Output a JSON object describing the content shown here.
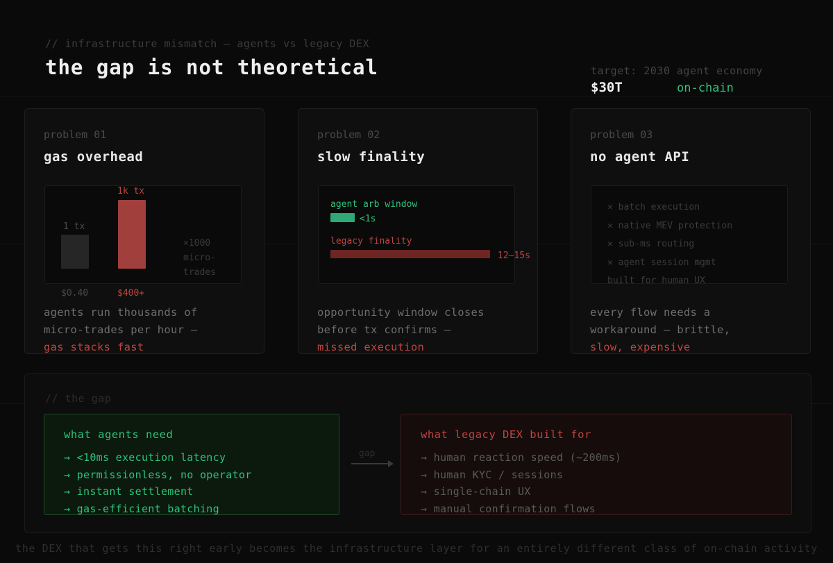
{
  "header": {
    "comment": "// infrastructure mismatch — agents vs legacy DEX",
    "title": "the gap is not theoretical",
    "target_label": "target: 2030 agent economy",
    "target_value": "$30T",
    "target_suffix": "on-chain"
  },
  "cards": [
    {
      "number": "problem 01",
      "title": "gas overhead",
      "chart": {
        "bars": [
          {
            "label": "1 tx",
            "value_label": "$0.40",
            "value": 0.4
          },
          {
            "label": "1k tx",
            "value_label": "$400+",
            "value": 400
          }
        ],
        "multiplier": [
          "×1000",
          "micro-",
          "trades"
        ]
      },
      "desc": [
        "agents run thousands of",
        "micro-trades per hour —"
      ],
      "desc_emphasis": "gas stacks fast"
    },
    {
      "number": "problem 02",
      "title": "slow finality",
      "timeline": {
        "arb_label": "agent arb window",
        "arb_value": "<1s",
        "legacy_label": "legacy finality",
        "legacy_value": "12–15s"
      },
      "desc": [
        "opportunity window closes",
        "before tx confirms —"
      ],
      "desc_emphasis": "missed execution"
    },
    {
      "number": "problem 03",
      "title": "no agent API",
      "missing": [
        "batch execution",
        "native MEV protection",
        "sub-ms routing",
        "agent session mgmt"
      ],
      "missing_footer": "built for human UX",
      "desc": [
        "every flow needs a",
        "workaround — brittle,"
      ],
      "desc_emphasis": "slow, expensive"
    }
  ],
  "gap": {
    "comment": "// the gap",
    "arrow_label": "gap",
    "need": {
      "title": "what agents need",
      "items": [
        "→ <10ms execution latency",
        "→ permissionless, no operator",
        "→ instant settlement",
        "→ gas-efficient batching"
      ]
    },
    "legacy": {
      "title": "what legacy DEX built for",
      "items": [
        "→ human reaction speed (~200ms)",
        "→ human KYC / sessions",
        "→ single-chain UX",
        "→ manual confirmation flows"
      ]
    }
  },
  "footer": "the DEX that gets this right early becomes the infrastructure layer for an entirely different class of on-chain activity",
  "colors": {
    "accent_green": "#2ec27e",
    "accent_red": "#c0443f",
    "background": "#0a0a0a"
  }
}
